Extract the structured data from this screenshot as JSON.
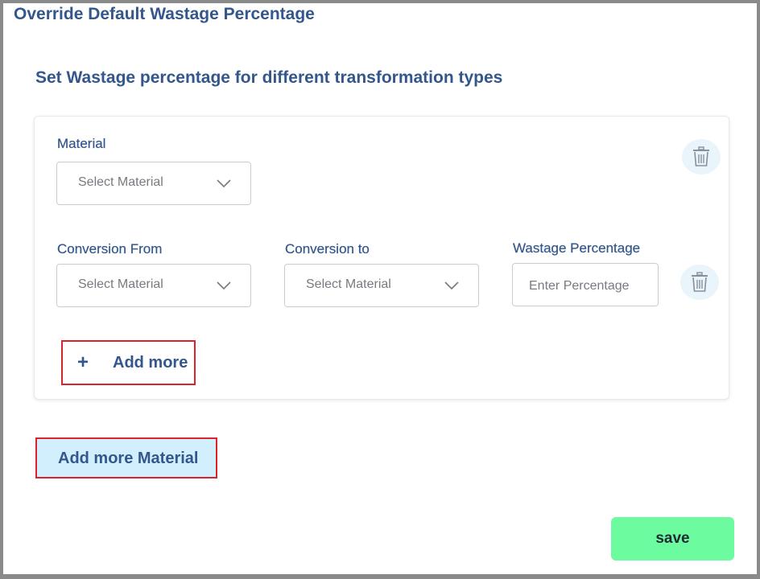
{
  "page": {
    "title": "Override Default Wastage Percentage",
    "section_title": "Set Wastage percentage for different transformation types"
  },
  "material_block": {
    "material_label": "Material",
    "material_placeholder": "Select Material",
    "conversion_from_label": "Conversion From",
    "conversion_from_placeholder": "Select Material",
    "conversion_to_label": "Conversion to",
    "conversion_to_placeholder": "Select Material",
    "wastage_label": "Wastage Percentage",
    "wastage_placeholder": "Enter Percentage",
    "add_more_icon": "+",
    "add_more_label": "Add more"
  },
  "actions": {
    "add_more_material_label": "Add more Material",
    "save_label": "save"
  },
  "icons": {
    "delete_material": "trash-icon",
    "delete_conversion": "trash-icon",
    "dropdown": "chevron-down-icon"
  },
  "colors": {
    "heading": "#33578c",
    "highlight_border": "#d9232e",
    "add_material_bg": "#d2effd",
    "save_bg": "#6dfba0",
    "trash_bg": "#eaf4fb"
  }
}
